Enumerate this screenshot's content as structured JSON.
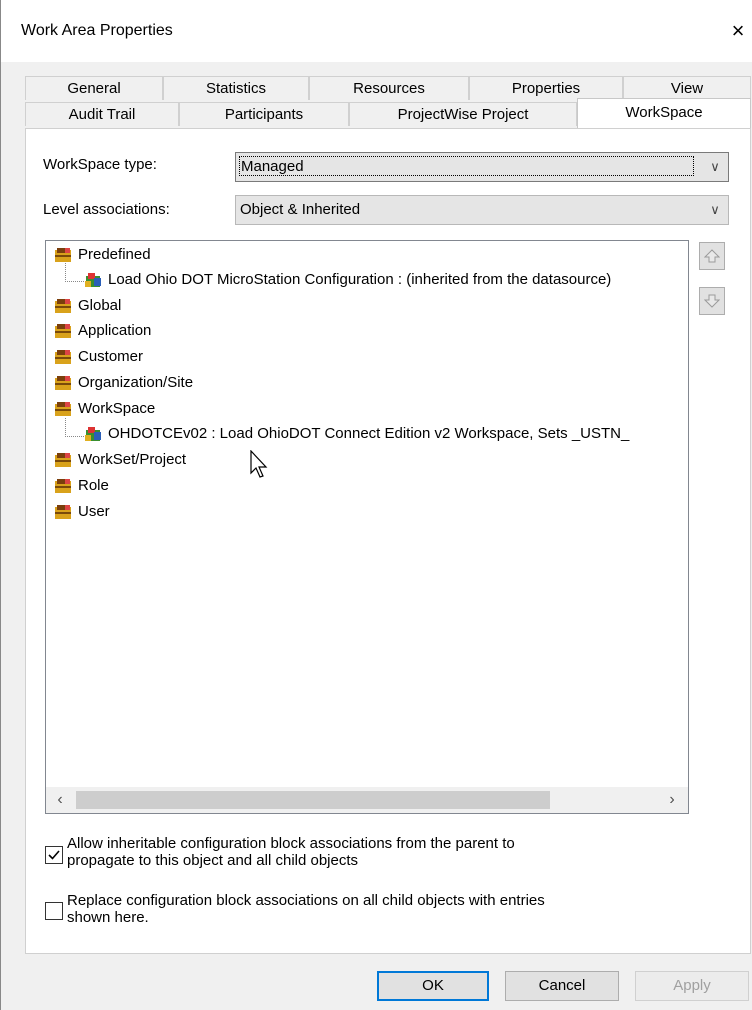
{
  "window": {
    "title": "Work Area Properties",
    "close_label": "×"
  },
  "tabs_row1": [
    "General",
    "Statistics",
    "Resources",
    "Properties",
    "View"
  ],
  "tabs_row2": [
    "Audit Trail",
    "Participants",
    "ProjectWise Project",
    "WorkSpace"
  ],
  "form": {
    "workspace_type_label": "WorkSpace type:",
    "workspace_type_value": "Managed",
    "level_assoc_label": "Level associations:",
    "level_assoc_value": "Object & Inherited"
  },
  "tree": [
    {
      "label": "Predefined",
      "level": 0
    },
    {
      "label": "Load Ohio DOT MicroStation Configuration :  (inherited from the datasource)",
      "level": 1
    },
    {
      "label": "Global",
      "level": 0
    },
    {
      "label": "Application",
      "level": 0
    },
    {
      "label": "Customer",
      "level": 0
    },
    {
      "label": "Organization/Site",
      "level": 0
    },
    {
      "label": "WorkSpace",
      "level": 0
    },
    {
      "label": "OHDOTCEv02 : Load OhioDOT Connect Edition v2 Workspace, Sets _USTN_",
      "level": 1
    },
    {
      "label": "WorkSet/Project",
      "level": 0
    },
    {
      "label": "Role",
      "level": 0
    },
    {
      "label": "User",
      "level": 0
    }
  ],
  "checkboxes": {
    "allow_inherit": {
      "checked": true,
      "line1": "Allow inheritable configuration block associations from the parent to",
      "line2": "propagate to this object and all child objects"
    },
    "replace": {
      "checked": false,
      "line1": "Replace configuration block associations on all child objects with entries",
      "line2": "shown here."
    }
  },
  "buttons": {
    "ok": "OK",
    "cancel": "Cancel",
    "apply": "Apply"
  },
  "icons": {
    "move_up": "move-up-icon",
    "move_down": "move-down-icon",
    "config_block": "config-block-icon"
  }
}
